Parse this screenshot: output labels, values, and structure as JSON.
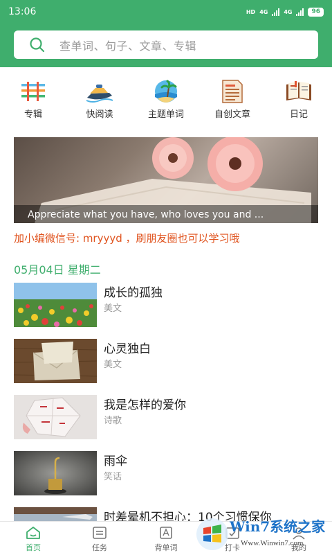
{
  "status": {
    "time": "13:06",
    "network_label": "HD",
    "signal_label": "4G",
    "battery": "96"
  },
  "search": {
    "placeholder": "查单词、句子、文章、专辑"
  },
  "shortcuts": [
    {
      "label": "专辑",
      "icon": "album-icon"
    },
    {
      "label": "快阅读",
      "icon": "jet-ski-icon"
    },
    {
      "label": "主题单词",
      "icon": "beach-icon"
    },
    {
      "label": "自创文章",
      "icon": "document-icon"
    },
    {
      "label": "日记",
      "icon": "diary-icon"
    }
  ],
  "banner": {
    "caption": "Appreciate what you have, who loves you and ..."
  },
  "promo": "加小编微信号: mryyyd ，刷朋友圈也可以学习哦",
  "date_heading": "05月04日 星期二",
  "articles": [
    {
      "title": "成长的孤独",
      "category": "美文"
    },
    {
      "title": "心灵独白",
      "category": "美文"
    },
    {
      "title": "我是怎样的爱你",
      "category": "诗歌"
    },
    {
      "title": "雨伞",
      "category": "笑话"
    },
    {
      "title": "时差晕机不担心：10个习惯保你",
      "category": ""
    }
  ],
  "tabs": [
    {
      "label": "首页",
      "icon": "home-icon",
      "active": true
    },
    {
      "label": "任务",
      "icon": "task-icon",
      "active": false
    },
    {
      "label": "背单词",
      "icon": "vocab-icon",
      "active": false
    },
    {
      "label": "打卡",
      "icon": "checkin-icon",
      "active": false
    },
    {
      "label": "我的",
      "icon": "profile-icon",
      "active": false
    }
  ],
  "watermark": {
    "brand": "Win7系统之家",
    "url": "Www.Winwin7.com"
  },
  "colors": {
    "primary": "#3fae6d",
    "promo": "#e0531e",
    "watermark": "#1e73c8"
  }
}
